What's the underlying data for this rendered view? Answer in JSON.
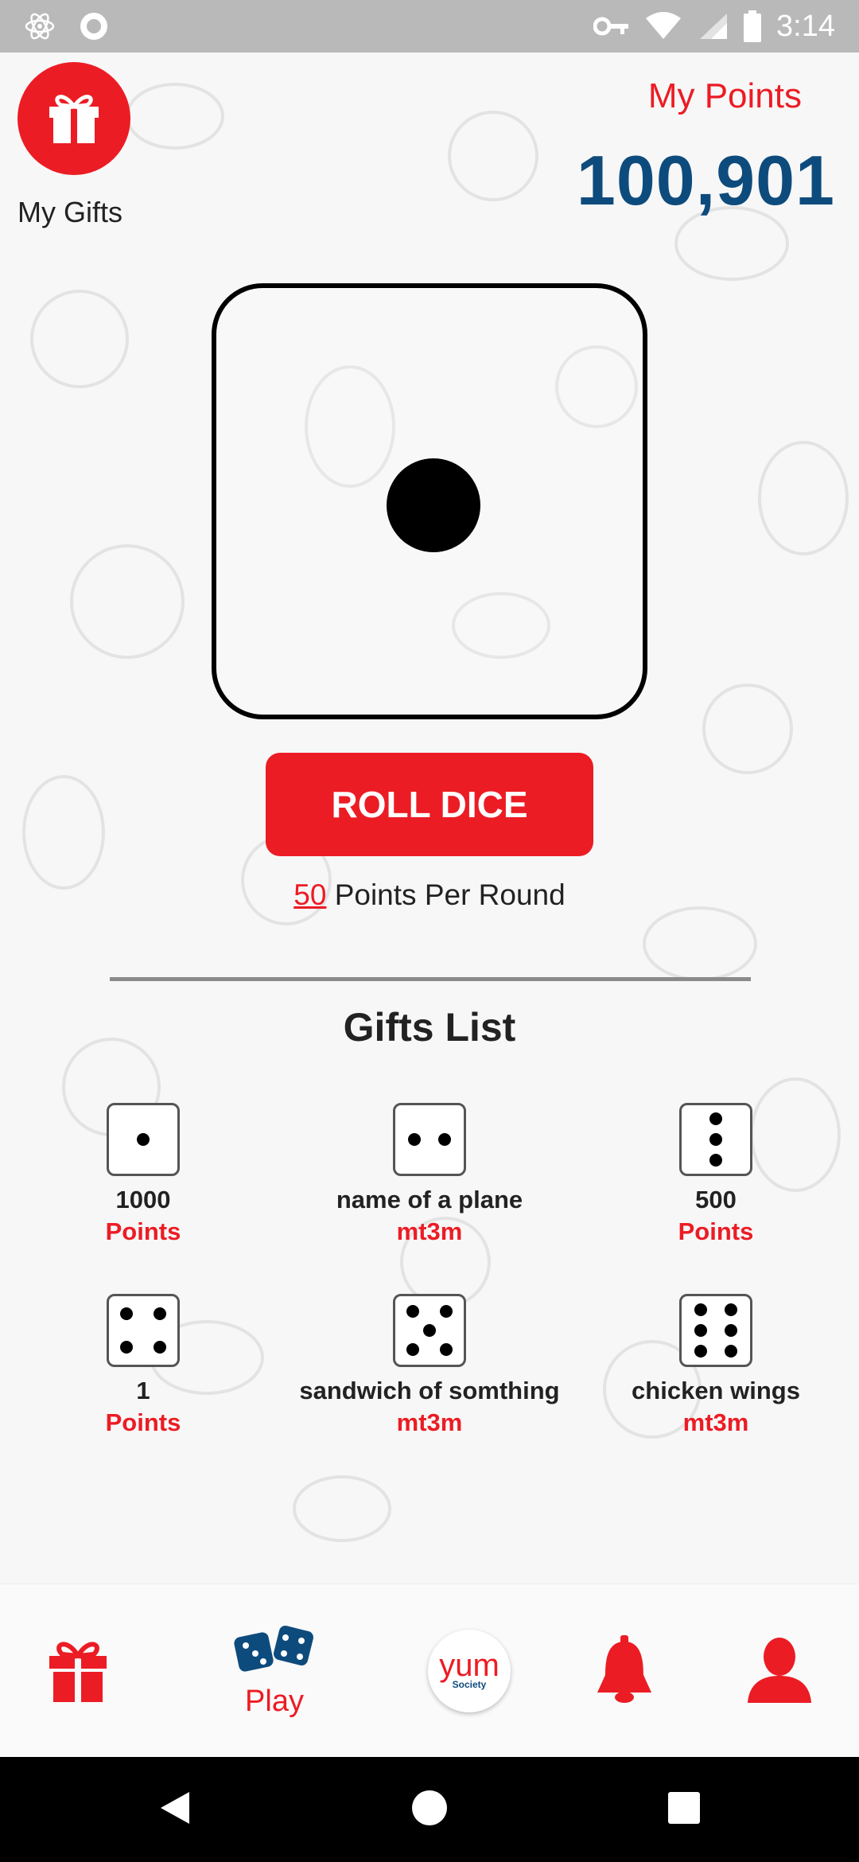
{
  "status_bar": {
    "time": "3:14"
  },
  "header": {
    "my_gifts_label": "My Gifts",
    "my_points_label": "My Points",
    "points_value": "100,901"
  },
  "dice": {
    "current_face": 1
  },
  "roll": {
    "button_label": "ROLL DICE",
    "cost": "50",
    "cost_suffix": "Points Per Round"
  },
  "gifts": {
    "title": "Gifts List",
    "items": [
      {
        "face": 1,
        "name": "1000",
        "unit": "Points"
      },
      {
        "face": 2,
        "name": "name of a plane",
        "unit": "mt3m"
      },
      {
        "face": 3,
        "name": "500",
        "unit": "Points"
      },
      {
        "face": 4,
        "name": "1",
        "unit": "Points"
      },
      {
        "face": 5,
        "name": "sandwich of somthing",
        "unit": "mt3m"
      },
      {
        "face": 6,
        "name": "chicken wings",
        "unit": "mt3m"
      }
    ]
  },
  "nav": {
    "play_label": "Play",
    "logo_text": "yum",
    "logo_sub": "Society",
    "icons": [
      "gift-icon",
      "dice-icon",
      "yum-logo",
      "bell-icon",
      "profile-icon"
    ]
  },
  "colors": {
    "accent": "#ec1c24",
    "points": "#0e4b7d",
    "background": "#f7f7f7"
  }
}
